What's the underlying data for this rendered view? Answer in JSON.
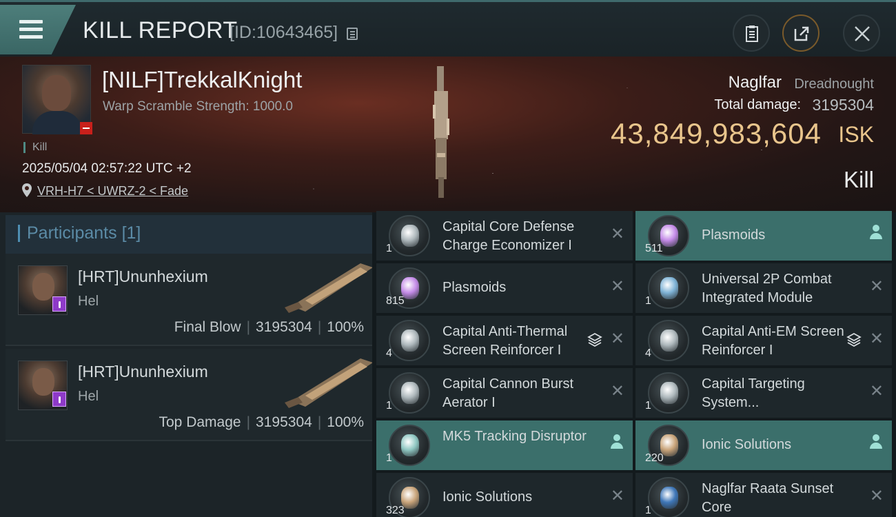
{
  "header": {
    "title": "KILL REPORT",
    "report_id": "[ID:10643465]"
  },
  "victim": {
    "name": "[NILF]TrekkalKnight",
    "scramble": "Warp Scramble Strength: 1000.0",
    "kill_tag": "Kill",
    "timestamp": "2025/05/04 02:57:22 UTC +2",
    "location": "VRH-H7 < UWRZ-2 < Fade",
    "ship_name": "Naglfar",
    "ship_class": "Dreadnought",
    "total_damage_label": "Total damage:",
    "total_damage": "3195304",
    "isk_value": "43,849,983,604",
    "isk_unit": "ISK",
    "result": "Kill"
  },
  "participants": {
    "label": "Participants",
    "count": "[1]",
    "rows": [
      {
        "name": "[HRT]Ununhexium",
        "ship": "Hel",
        "role": "Final Blow",
        "damage": "3195304",
        "percent": "100%"
      },
      {
        "name": "[HRT]Ununhexium",
        "ship": "Hel",
        "role": "Top Damage",
        "damage": "3195304",
        "percent": "100%"
      }
    ]
  },
  "items": [
    {
      "name": "Capital Core Defense Charge Economizer I",
      "qty": "1",
      "state": "destroyed",
      "icon": "rig-icon"
    },
    {
      "name": "Plasmoids",
      "qty": "511",
      "state": "dropped",
      "icon": "plasmoid-icon"
    },
    {
      "name": "Plasmoids",
      "qty": "815",
      "state": "destroyed",
      "icon": "plasmoid-icon"
    },
    {
      "name": "Universal 2P Combat Integrated Module",
      "qty": "1",
      "state": "destroyed",
      "icon": "module-icon"
    },
    {
      "name": "Capital Anti-Thermal Screen Reinforcer I",
      "qty": "4",
      "state": "destroyed",
      "stacked": true,
      "icon": "rig-icon"
    },
    {
      "name": "Capital Anti-EM Screen Reinforcer I",
      "qty": "4",
      "state": "destroyed",
      "stacked": true,
      "icon": "rig-icon"
    },
    {
      "name": "Capital Cannon Burst Aerator I",
      "qty": "1",
      "state": "destroyed",
      "icon": "rig-icon"
    },
    {
      "name": "Capital Targeting System...",
      "qty": "1",
      "state": "destroyed",
      "icon": "rig-icon"
    },
    {
      "name": "MK5 Tracking Disruptor",
      "qty": "1",
      "state": "dropped",
      "icon": "disruptor-icon"
    },
    {
      "name": "Ionic Solutions",
      "qty": "220",
      "state": "dropped",
      "icon": "canister-icon"
    },
    {
      "name": "Ionic Solutions",
      "qty": "323",
      "state": "destroyed",
      "icon": "canister-icon"
    },
    {
      "name": "Naglfar Raata Sunset Core",
      "qty": "1",
      "state": "destroyed",
      "icon": "core-icon"
    }
  ],
  "colors": {
    "accent_teal": "#3b6f6b",
    "isk_gold": "#e9c58c",
    "badge_red": "#c8201b",
    "badge_purple": "#8e3ac8"
  }
}
